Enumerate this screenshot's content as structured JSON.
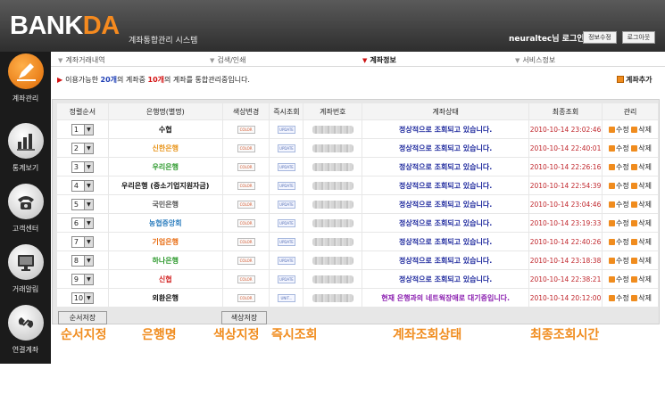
{
  "header": {
    "logo_main": "BANK",
    "logo_accent": "DA",
    "system_title": "계좌통합관리 시스템",
    "user_text": "neuraltec님 로그인",
    "btn_info": "정보수정",
    "btn_logout": "로그아웃"
  },
  "sidebar": [
    {
      "label": "계좌관리",
      "icon": "pen-icon",
      "active": true
    },
    {
      "label": "통계보기",
      "icon": "bar-chart-icon",
      "active": false
    },
    {
      "label": "고객센터",
      "icon": "phone-icon",
      "active": false
    },
    {
      "label": "거래알림",
      "icon": "monitor-icon",
      "active": false
    },
    {
      "label": "연결계좌",
      "icon": "link-icon",
      "active": false
    }
  ],
  "tabs": [
    "계좌거래내역",
    "검색/인쇄",
    "계좌정보",
    "서비스정보"
  ],
  "active_tab": 2,
  "notice": {
    "prefix": "이용가능한 ",
    "total": "20개",
    "mid": "의 계좌중 ",
    "used": "10개",
    "suffix": "의 계좌를 통합관리중입니다."
  },
  "add_account": "계좌추가",
  "table": {
    "headers": [
      "정렬순서",
      "은행명(별명)",
      "색상변경",
      "즉시조회",
      "계좌번호",
      "계좌상태",
      "최종조회",
      "관리"
    ],
    "color_chip_text": "COLOR",
    "update_chip_text": "UPDATE",
    "unit_chip_text": "UNIT...",
    "edit_label": "수정",
    "delete_label": "삭제",
    "rows": [
      {
        "order": "1",
        "bank": "수협",
        "color": "#111111",
        "status": "정상적으로 조회되고 있습니다.",
        "last": "2010-10-14 23:02:46",
        "error": false
      },
      {
        "order": "2",
        "bank": "신한은행",
        "color": "#e8951c",
        "status": "정상적으로 조회되고 있습니다.",
        "last": "2010-10-14 22:40:01",
        "error": false
      },
      {
        "order": "3",
        "bank": "우리은행",
        "color": "#2e9a2e",
        "status": "정상적으로 조회되고 있습니다.",
        "last": "2010-10-14 22:26:16",
        "error": false
      },
      {
        "order": "4",
        "bank": "우리은행 (중소기업지원자금)",
        "color": "#111111",
        "status": "정상적으로 조회되고 있습니다.",
        "last": "2010-10-14 22:54:39",
        "error": false
      },
      {
        "order": "5",
        "bank": "국민은행",
        "color": "#555555",
        "status": "정상적으로 조회되고 있습니다.",
        "last": "2010-10-14 23:04:46",
        "error": false
      },
      {
        "order": "6",
        "bank": "농협중앙회",
        "color": "#2f7fbf",
        "status": "정상적으로 조회되고 있습니다.",
        "last": "2010-10-14 23:19:33",
        "error": false
      },
      {
        "order": "7",
        "bank": "기업은행",
        "color": "#e86c12",
        "status": "정상적으로 조회되고 있습니다.",
        "last": "2010-10-14 22:40:26",
        "error": false
      },
      {
        "order": "8",
        "bank": "하나은행",
        "color": "#2e9a2e",
        "status": "정상적으로 조회되고 있습니다.",
        "last": "2010-10-14 23:18:38",
        "error": false
      },
      {
        "order": "9",
        "bank": "신협",
        "color": "#d21f1f",
        "status": "정상적으로 조회되고 있습니다.",
        "last": "2010-10-14 22:38:21",
        "error": false
      },
      {
        "order": "10",
        "bank": "외환은행",
        "color": "#111111",
        "status": "현재 은행과의 네트웍장애로 대기중입니다.",
        "last": "2010-10-14 20:12:00",
        "error": true
      }
    ]
  },
  "buttons": {
    "save_order": "순서저장",
    "save_color": "색상저장"
  },
  "annotations": [
    "순서지정",
    "은행명",
    "색상지정",
    "즉시조회",
    "계좌조회상태",
    "최종조회시간"
  ]
}
